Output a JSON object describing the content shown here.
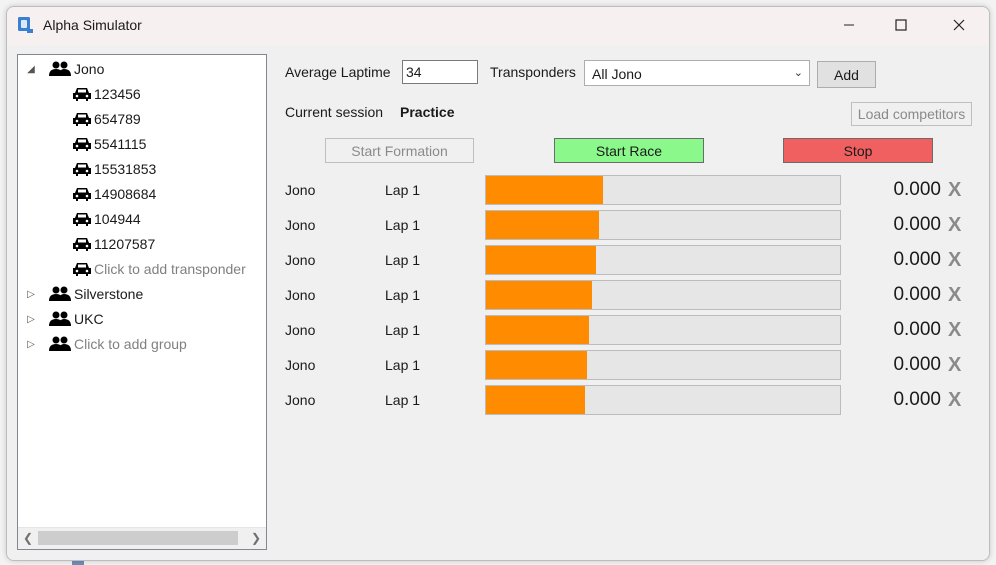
{
  "window": {
    "title": "Alpha Simulator",
    "minimize_icon": "minimize-icon",
    "maximize_icon": "maximize-icon",
    "close_icon": "close-icon"
  },
  "tree": {
    "groups": [
      {
        "name": "Jono",
        "expanded": true,
        "transponders": [
          "123456",
          "654789",
          "5541115",
          "15531853",
          "14908684",
          "104944",
          "11207587"
        ],
        "add_transponder_label": "Click to add transponder"
      },
      {
        "name": "Silverstone",
        "expanded": false
      },
      {
        "name": "UKC",
        "expanded": false
      }
    ],
    "add_group_label": "Click to add group",
    "group_icon": "people-icon",
    "transponder_icon": "car-icon"
  },
  "controls": {
    "avg_laptime_label": "Average Laptime",
    "avg_laptime_value": "34",
    "transponders_label": "Transponders",
    "transponders_selected": "All Jono",
    "add_label": "Add",
    "current_session_label": "Current session",
    "current_session_value": "Practice",
    "load_competitors_label": "Load competitors",
    "start_formation_label": "Start Formation",
    "start_race_label": "Start Race",
    "stop_label": "Stop"
  },
  "colors": {
    "start_race": "#8af88a",
    "stop": "#f06060",
    "bar_fill": "#ff8c00"
  },
  "competitors": [
    {
      "name": "Jono",
      "lap": "Lap 1",
      "progress": 0.33,
      "time": "0.000",
      "remove": "X"
    },
    {
      "name": "Jono",
      "lap": "Lap 1",
      "progress": 0.32,
      "time": "0.000",
      "remove": "X"
    },
    {
      "name": "Jono",
      "lap": "Lap 1",
      "progress": 0.31,
      "time": "0.000",
      "remove": "X"
    },
    {
      "name": "Jono",
      "lap": "Lap 1",
      "progress": 0.3,
      "time": "0.000",
      "remove": "X"
    },
    {
      "name": "Jono",
      "lap": "Lap 1",
      "progress": 0.29,
      "time": "0.000",
      "remove": "X"
    },
    {
      "name": "Jono",
      "lap": "Lap 1",
      "progress": 0.285,
      "time": "0.000",
      "remove": "X"
    },
    {
      "name": "Jono",
      "lap": "Lap 1",
      "progress": 0.28,
      "time": "0.000",
      "remove": "X"
    }
  ]
}
